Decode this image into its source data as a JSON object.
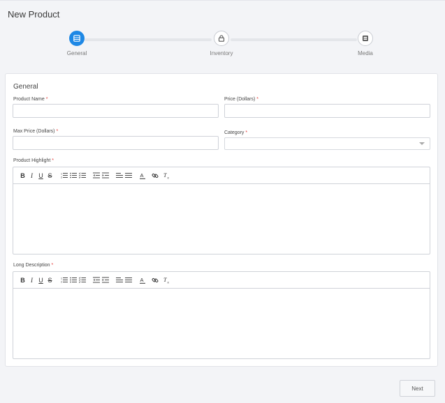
{
  "page": {
    "title": "New Product"
  },
  "stepper": {
    "steps": [
      {
        "label": "General",
        "icon": "form-icon",
        "active": true
      },
      {
        "label": "Inventory",
        "icon": "lock-icon",
        "active": false
      },
      {
        "label": "Media",
        "icon": "media-icon",
        "active": false
      }
    ],
    "active_color": "#1e88e5"
  },
  "form": {
    "section_title": "General",
    "product_name": {
      "label": "Product Name",
      "value": "",
      "placeholder": ""
    },
    "price": {
      "label": "Price (Dollars)",
      "value": "",
      "placeholder": ""
    },
    "max_price": {
      "label": "Max Price (Dollars)",
      "value": "",
      "placeholder": ""
    },
    "category": {
      "label": "Category",
      "selected": ""
    },
    "product_highlight": {
      "label": "Product Highlight"
    },
    "long_description": {
      "label": "Long Description"
    },
    "required_mark": "*"
  },
  "toolbar_icons": [
    "bold-icon",
    "italic-icon",
    "underline-icon",
    "strikethrough-icon",
    "ordered-list-icon",
    "bullet-list-icon",
    "check-list-icon",
    "outdent-icon",
    "indent-icon",
    "align-left-icon",
    "align-justify-icon",
    "text-color-icon",
    "link-icon",
    "clear-format-icon"
  ],
  "actions": {
    "next_label": "Next"
  }
}
